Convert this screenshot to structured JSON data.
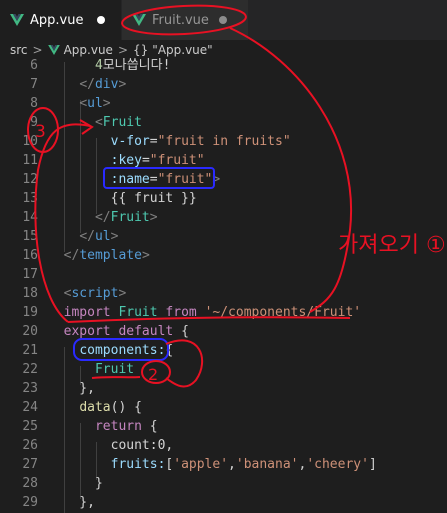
{
  "tabs": [
    {
      "label": "App.vue",
      "active": true,
      "modified": true
    },
    {
      "label": "Fruit.vue",
      "active": false,
      "modified": true
    }
  ],
  "breadcrumb": [
    "src",
    "App.vue",
    "\"App.vue\""
  ],
  "code_lines": [
    {
      "n": "6",
      "text": "      4모나씁니다!"
    },
    {
      "n": "7",
      "text": "    </div>"
    },
    {
      "n": "8",
      "text": "    <ul>"
    },
    {
      "n": "9",
      "text": "      <Fruit"
    },
    {
      "n": "10",
      "text": "        v-for=\"fruit in fruits\""
    },
    {
      "n": "11",
      "text": "        :key=\"fruit\""
    },
    {
      "n": "12",
      "text": "        :name=\"fruit\">"
    },
    {
      "n": "13",
      "text": "        {{ fruit }}"
    },
    {
      "n": "14",
      "text": "      </Fruit>"
    },
    {
      "n": "15",
      "text": "    </ul>"
    },
    {
      "n": "16",
      "text": "  </template>"
    },
    {
      "n": "17",
      "text": ""
    },
    {
      "n": "18",
      "text": "  <script>"
    },
    {
      "n": "19",
      "text": "  import Fruit from '~/components/Fruit'"
    },
    {
      "n": "20",
      "text": "  export default {"
    },
    {
      "n": "21",
      "text": "    components:{"
    },
    {
      "n": "22",
      "text": "      Fruit"
    },
    {
      "n": "23",
      "text": "    },"
    },
    {
      "n": "24",
      "text": "    data() {"
    },
    {
      "n": "25",
      "text": "      return {"
    },
    {
      "n": "26",
      "text": "        count:0,"
    },
    {
      "n": "27",
      "text": "        fruits:['apple','banana','cheery']"
    },
    {
      "n": "28",
      "text": "      }"
    },
    {
      "n": "29",
      "text": "    },"
    }
  ],
  "annotations": {
    "handwritten_note": "가져오기 ①",
    "mark_1": "3",
    "mark_2": "2"
  },
  "colors": {
    "background": "#1e1e1e",
    "tabbar": "#252526",
    "tag": "#569cd6",
    "component": "#4ec9b0",
    "attribute": "#9cdcfe",
    "string": "#ce9178",
    "keyword": "#c586c0",
    "function": "#dcdcaa",
    "number": "#b5cea8",
    "vue_icon": "#41b883",
    "annotation_red": "#e81123",
    "annotation_blue": "#2a2aff"
  }
}
